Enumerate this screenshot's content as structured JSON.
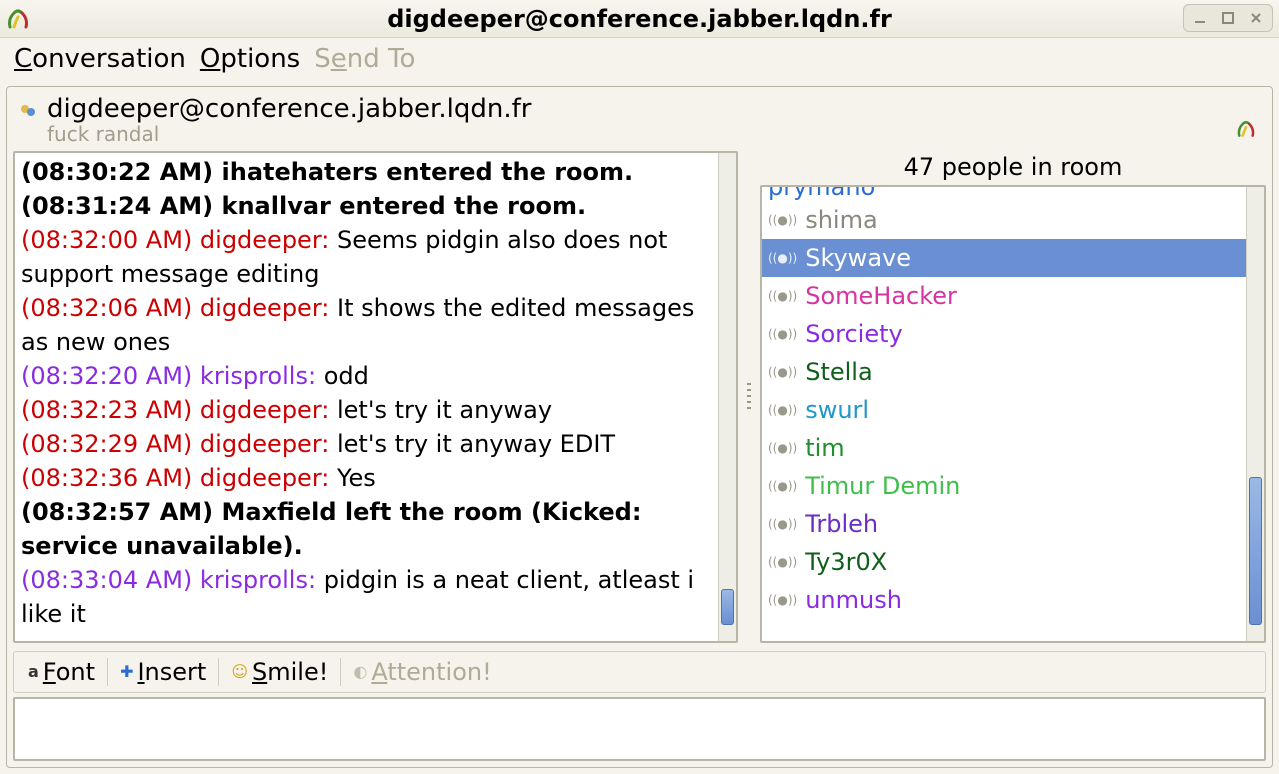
{
  "window": {
    "title": "digdeeper@conference.jabber.lqdn.fr"
  },
  "menu": {
    "conversation": "Conversation",
    "options": "Options",
    "send_to": "Send To"
  },
  "header": {
    "room": "digdeeper@conference.jabber.lqdn.fr",
    "topic": "fuck randal"
  },
  "roster": {
    "count_label": "47 people in room",
    "partial_top": "prymano",
    "items": [
      {
        "name": "shima",
        "color": "nm-gray",
        "selected": false
      },
      {
        "name": "Skywave",
        "color": "nm-white",
        "selected": true
      },
      {
        "name": "SomeHacker",
        "color": "nm-magenta",
        "selected": false
      },
      {
        "name": "Sorciety",
        "color": "nm-purple",
        "selected": false
      },
      {
        "name": "Stella",
        "color": "nm-darkgreen",
        "selected": false
      },
      {
        "name": "swurl",
        "color": "nm-cyan",
        "selected": false
      },
      {
        "name": "tim",
        "color": "nm-green",
        "selected": false
      },
      {
        "name": "Timur Demin",
        "color": "nm-lime",
        "selected": false
      },
      {
        "name": "Trbleh",
        "color": "nm-dpurple",
        "selected": false
      },
      {
        "name": "Ty3r0X",
        "color": "nm-darkgreen",
        "selected": false
      },
      {
        "name": "unmush",
        "color": "nm-purple",
        "selected": false
      }
    ]
  },
  "messages": [
    {
      "ts": "(08:30:22 AM)",
      "nick": "",
      "nick_color": "",
      "sep": " ",
      "text": "ihatehaters entered the room.",
      "bold": true,
      "ts_color": "c-black"
    },
    {
      "ts": "(08:31:24 AM)",
      "nick": "",
      "nick_color": "",
      "sep": " ",
      "text": "knallvar entered the room.",
      "bold": true,
      "ts_color": "c-black"
    },
    {
      "ts": "(08:32:00 AM)",
      "nick": "digdeeper:",
      "nick_color": "c-red",
      "sep": " ",
      "text": "Seems pidgin also does not support message editing",
      "bold": false,
      "ts_color": "c-red"
    },
    {
      "ts": "(08:32:06 AM)",
      "nick": "digdeeper:",
      "nick_color": "c-red",
      "sep": " ",
      "text": "It shows the edited messages as new ones",
      "bold": false,
      "ts_color": "c-red"
    },
    {
      "ts": "(08:32:20 AM)",
      "nick": "krisprolls:",
      "nick_color": "c-purple",
      "sep": " ",
      "text": "odd",
      "bold": false,
      "ts_color": "c-purple"
    },
    {
      "ts": "(08:32:23 AM)",
      "nick": "digdeeper:",
      "nick_color": "c-red",
      "sep": " ",
      "text": "let's try it anyway",
      "bold": false,
      "ts_color": "c-red"
    },
    {
      "ts": "(08:32:29 AM)",
      "nick": "digdeeper:",
      "nick_color": "c-red",
      "sep": " ",
      "text": "let's try it anyway EDIT",
      "bold": false,
      "ts_color": "c-red"
    },
    {
      "ts": "(08:32:36 AM)",
      "nick": "digdeeper:",
      "nick_color": "c-red",
      "sep": " ",
      "text": "Yes",
      "bold": false,
      "ts_color": "c-red"
    },
    {
      "ts": "(08:32:57 AM)",
      "nick": "",
      "nick_color": "",
      "sep": " ",
      "text": "Maxfield left the room (Kicked: service unavailable).",
      "bold": true,
      "ts_color": "c-black"
    },
    {
      "ts": "(08:33:04 AM)",
      "nick": "krisprolls:",
      "nick_color": "c-purple",
      "sep": " ",
      "text": "pidgin is a neat client, atleast i like it",
      "bold": false,
      "ts_color": "c-purple"
    }
  ],
  "toolbar": {
    "font": "Font",
    "insert": "Insert",
    "smile": "Smile!",
    "attention": "Attention!"
  },
  "input": {
    "value": ""
  }
}
